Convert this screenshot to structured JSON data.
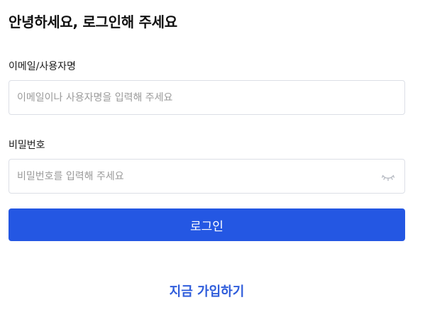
{
  "page": {
    "title": "안녕하세요, 로그인해 주세요"
  },
  "email_field": {
    "label": "이메일/사용자명",
    "value": "",
    "placeholder": "이메일이나 사용자명을 입력해 주세요"
  },
  "password_field": {
    "label": "비밀번호",
    "value": "",
    "placeholder": "비밀번호를 입력해 주세요",
    "toggle_icon": "eye-closed-icon"
  },
  "login_button": {
    "label": "로그인"
  },
  "signup_link": {
    "label": "지금 가입하기"
  },
  "colors": {
    "accent": "#2457e3",
    "link": "#2f5ddb",
    "border": "#dcdfe6",
    "placeholder": "#9a9a9a"
  }
}
